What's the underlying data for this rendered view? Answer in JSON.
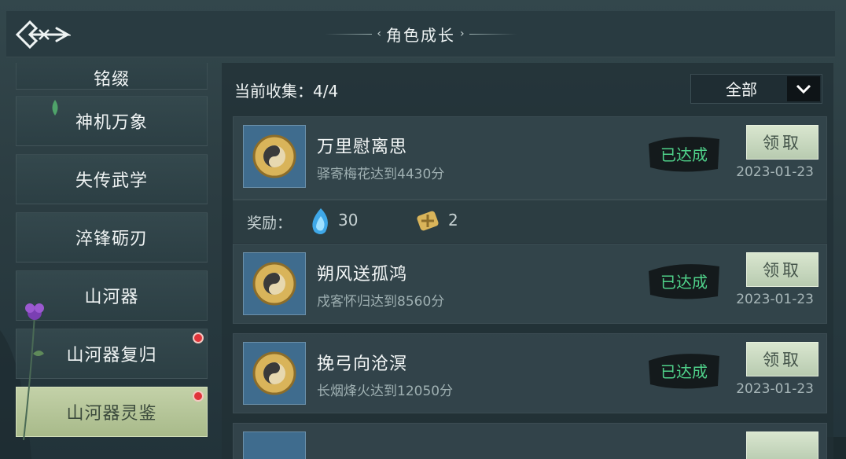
{
  "header": {
    "title": "角色成长"
  },
  "sidebar": {
    "items": [
      {
        "label": "铭缀",
        "active": false,
        "badge": false
      },
      {
        "label": "神机万象",
        "active": false,
        "badge": false
      },
      {
        "label": "失传武学",
        "active": false,
        "badge": false
      },
      {
        "label": "淬锋砺刃",
        "active": false,
        "badge": false
      },
      {
        "label": "山河器",
        "active": false,
        "badge": false
      },
      {
        "label": "山河器复归",
        "active": false,
        "badge": true
      },
      {
        "label": "山河器灵鉴",
        "active": true,
        "badge": true
      }
    ]
  },
  "main": {
    "collect_label": "当前收集：4/4",
    "filter": {
      "selected": "全部"
    },
    "achievements": [
      {
        "title": "万里慰离思",
        "desc": "驿寄梅花达到4430分",
        "status": "已达成",
        "button": "领取",
        "date": "2023-01-23"
      },
      {
        "title": "朔风送孤鸿",
        "desc": "戍客怀归达到8560分",
        "status": "已达成",
        "button": "领取",
        "date": "2023-01-23"
      },
      {
        "title": "挽弓向沧溟",
        "desc": "长烟烽火达到12050分",
        "status": "已达成",
        "button": "领取",
        "date": "2023-01-23"
      }
    ],
    "reward": {
      "label": "奖励：",
      "items": [
        {
          "icon": "blue-flame-icon",
          "amount": "30"
        },
        {
          "icon": "gold-knot-icon",
          "amount": "2"
        }
      ]
    }
  },
  "colors": {
    "accent": "#b8cbb0",
    "badge": "#e0343a",
    "stamp": "#3fc27a",
    "icon_bg": "#3f6c8e"
  }
}
